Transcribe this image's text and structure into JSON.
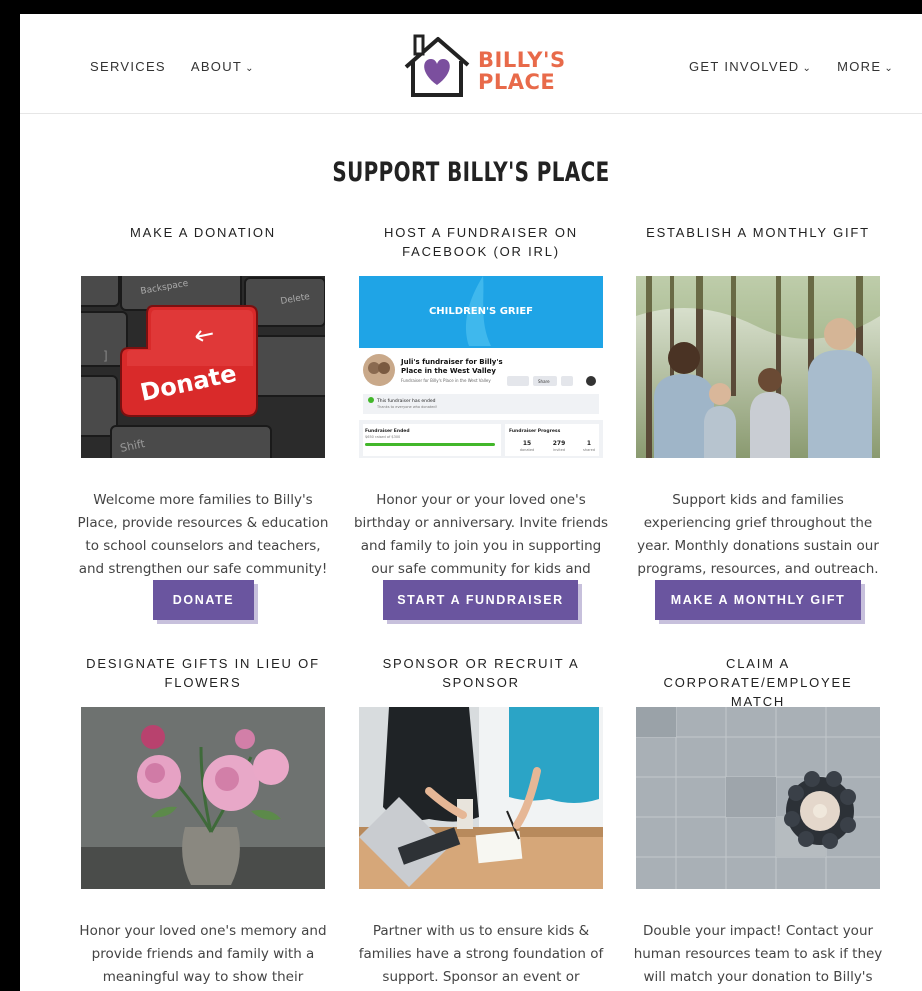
{
  "nav": {
    "left": [
      {
        "label": "SERVICES"
      },
      {
        "label": "ABOUT",
        "chevron": true
      }
    ],
    "right": [
      {
        "label": "GET INVOLVED",
        "chevron": true
      },
      {
        "label": "MORE",
        "chevron": true
      }
    ],
    "logo": {
      "line1": "BILLY'S",
      "line2": "PLACE",
      "brand_color": "#e86a4a",
      "heart_color": "#7b4f9e"
    }
  },
  "page_title": "SUPPORT BILLY'S PLACE",
  "accent_color": "#6a559f",
  "cards": [
    {
      "title": "MAKE A DONATION",
      "desc": "Welcome more families to Billy's Place, provide resources & education to school counselors and teachers, and strengthen our safe community!",
      "button": "DONATE",
      "image_text": {
        "key_donate": "Donate",
        "key_backspace": "Backspace",
        "key_delete": "Delete",
        "key_shift": "Shift"
      }
    },
    {
      "title": "HOST A FUNDRAISER ON FACEBOOK (OR IRL)",
      "desc": "Honor your or your loved one's birthday or anniversary. Invite friends and family to join you in supporting our safe community for kids and families.",
      "button": "START A FUNDRAISER",
      "image_text": {
        "banner": "CHILDREN'S GRIEF",
        "fr_title": "Juli's fundraiser for Billy's Place in the West Valley",
        "fr_sub": "Fundraiser for Billy's Place in the West Valley",
        "fr_by": "by Juli Ann",
        "ended": "This fundraiser has ended",
        "thanks": "Thanks to everyone who donated!",
        "ended_label": "Fundraiser Ended",
        "progress_label": "Fundraiser Progress",
        "donated": "15",
        "invited": "279",
        "shared": "1",
        "donated_l": "donated",
        "invited_l": "invited",
        "shared_l": "shared",
        "share": "Share",
        "amount": "$650 raised of $300"
      }
    },
    {
      "title": "ESTABLISH A MONTHLY GIFT",
      "desc": "Support kids and families experiencing grief throughout the year. Monthly donations sustain our programs, resources, and outreach.",
      "button": "MAKE A MONTHLY GIFT"
    },
    {
      "title": "DESIGNATE GIFTS IN LIEU OF FLOWERS",
      "desc": "Honor your loved one's memory and provide friends and family with a meaningful way to show their support."
    },
    {
      "title": "SPONSOR OR RECRUIT A SPONSOR",
      "desc": "Partner with us to ensure kids & families have a strong foundation of support. Sponsor an event or program or introduce Billy's Place to your network."
    },
    {
      "title": "CLAIM A CORPORATE/EMPLOYEE MATCH",
      "desc": "Double your impact! Contact your human resources team to ask if they will match your donation to Billy's Place."
    }
  ]
}
